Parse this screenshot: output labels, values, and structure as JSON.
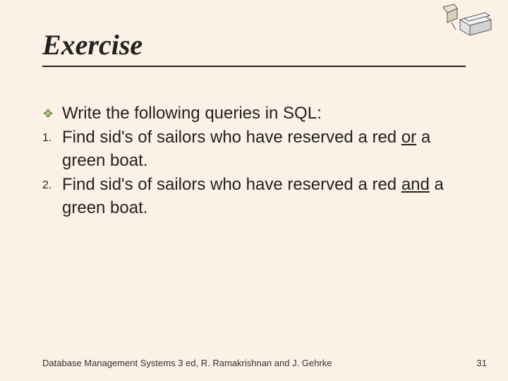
{
  "title": "Exercise",
  "intro": "Write the following queries in SQL:",
  "items": [
    {
      "num": "1.",
      "pre": "Find sid's of sailors who have reserved a red ",
      "u": "or",
      "post": " a green boat."
    },
    {
      "num": "2.",
      "pre": "Find sid's of sailors who have reserved a red ",
      "u": "and",
      "post": " a green boat."
    }
  ],
  "footer_left": "Database Management Systems 3 ed,  R. Ramakrishnan and J. Gehrke",
  "footer_right": "31"
}
